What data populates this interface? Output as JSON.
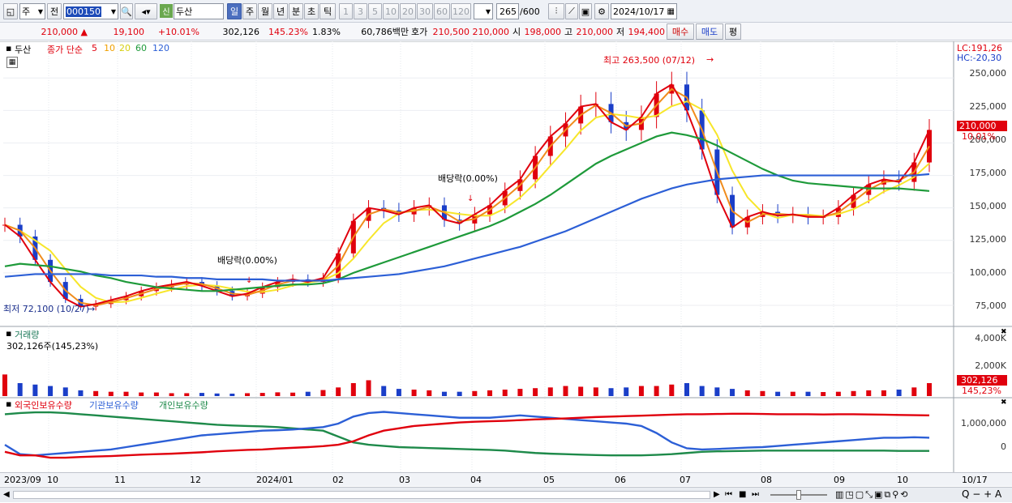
{
  "toolbar": {
    "market": "주",
    "scope": "전",
    "code": "000150",
    "name": "두산",
    "new_badge": "신",
    "period_tabs": [
      "일",
      "주",
      "월",
      "년",
      "분",
      "초",
      "틱"
    ],
    "intervals": [
      "1",
      "3",
      "5",
      "10",
      "20",
      "30",
      "60",
      "120"
    ],
    "count": "265",
    "count_total": "/600",
    "date": "2024/10/17"
  },
  "quote": {
    "price": "210,000",
    "change": "19,100",
    "change_rate": "+10.01%",
    "volume": "302,126",
    "volume_rate": "145.23%",
    "turnover_rate": "1.83%",
    "amount": "60,786백만",
    "ask_label": "호가",
    "ask": "210,500",
    "bid": "210,000",
    "open_label": "시",
    "open": "198,000",
    "high_label": "고",
    "high": "210,000",
    "low_label": "저",
    "low": "194,400",
    "buy": "매수",
    "sell": "매도",
    "flat": "평"
  },
  "price_pane": {
    "name": "두산",
    "legend_title": "종가 단순",
    "ma": [
      {
        "label": "5",
        "color": "#e0000d"
      },
      {
        "label": "10",
        "color": "#f08c1c"
      },
      {
        "label": "20",
        "color": "#e8e22b"
      },
      {
        "label": "60",
        "color": "#1e9a3a"
      },
      {
        "label": "120",
        "color": "#2c5fd6"
      }
    ],
    "high_note": "최고 263,500 (07/12)",
    "low_note": "최저 72,100 (10/27)",
    "dividend_1": "배당락(0.00%)",
    "dividend_2": "배당락(0.00%)",
    "lc": "LC:191,26",
    "hc": "HC:-20,30",
    "yticks": [
      "250,000",
      "225,000",
      "200,000",
      "175,000",
      "150,000",
      "125,000",
      "100,000",
      "75,000"
    ],
    "price_tag": "210,000",
    "price_tag_rate": "10.01%"
  },
  "volume_pane": {
    "title": "거래량",
    "info": "302,126주(145,23%)",
    "yticks": [
      "4,000K",
      "2,000K"
    ],
    "tag": "302,126",
    "tag_rate": "145,23%"
  },
  "holding_pane": {
    "series": [
      {
        "label": "외국인보유수량",
        "color": "#e0000d"
      },
      {
        "label": "기관보유수량",
        "color": "#2c5fd6"
      },
      {
        "label": "개인보유수량",
        "color": "#1e8a4a"
      }
    ],
    "yticks": [
      "1,000,000",
      "0"
    ]
  },
  "xaxis": {
    "labels": [
      "2023/09",
      "10",
      "11",
      "12",
      "2024/01",
      "02",
      "03",
      "04",
      "05",
      "06",
      "07",
      "08",
      "09",
      "10"
    ],
    "end_label": "10/17"
  },
  "chart_data": {
    "type": "line",
    "title": "두산 000150",
    "ylabel": "",
    "ylim": [
      60000,
      272000
    ],
    "series": [
      {
        "name": "종가",
        "values": [
          137000,
          128000,
          110000,
          93000,
          80000,
          74000,
          76000,
          79000,
          82000,
          86000,
          89000,
          91000,
          93000,
          90000,
          86000,
          82000,
          84000,
          89000,
          93000,
          95000,
          93000,
          96000,
          115000,
          140000,
          150000,
          148000,
          145000,
          150000,
          152000,
          141000,
          138000,
          145000,
          152000,
          163000,
          172000,
          190000,
          205000,
          215000,
          228000,
          230000,
          216000,
          210000,
          220000,
          238000,
          245000,
          225000,
          195000,
          160000,
          135000,
          143000,
          147000,
          144000,
          145000,
          143000,
          143000,
          150000,
          160000,
          168000,
          172000,
          170000,
          185000,
          210000
        ]
      },
      {
        "name": "60",
        "values": [
          105000,
          107000,
          106000,
          105000,
          103000,
          101000,
          98000,
          96000,
          93000,
          91000,
          89000,
          88000,
          87000,
          86000,
          86000,
          87000,
          88000,
          89000,
          90000,
          91000,
          91000,
          92000,
          95000,
          100000,
          104000,
          108000,
          112000,
          116000,
          120000,
          124000,
          128000,
          132000,
          136000,
          141000,
          147000,
          153000,
          160000,
          168000,
          176000,
          184000,
          190000,
          195000,
          200000,
          205000,
          208000,
          206000,
          203000,
          198000,
          192000,
          186000,
          180000,
          175000,
          171000,
          169000,
          168000,
          167000,
          166000,
          165000,
          165000,
          165000,
          164000,
          163000
        ]
      },
      {
        "name": "120",
        "values": [
          97000,
          98000,
          99000,
          99000,
          99000,
          99000,
          99000,
          98000,
          98000,
          98000,
          97000,
          97000,
          96000,
          96000,
          95000,
          95000,
          95000,
          95000,
          94000,
          94000,
          94000,
          94000,
          95000,
          96000,
          97000,
          98000,
          99000,
          101000,
          103000,
          105000,
          108000,
          111000,
          114000,
          117000,
          120000,
          124000,
          128000,
          132000,
          137000,
          142000,
          147000,
          152000,
          157000,
          161000,
          165000,
          168000,
          170000,
          172000,
          173000,
          174000,
          175000,
          175000,
          175000,
          175000,
          175000,
          175000,
          175000,
          175000,
          175000,
          175000,
          175000,
          176000
        ]
      }
    ],
    "volume_bars_k": [
      1500,
      900,
      800,
      700,
      600,
      400,
      350,
      300,
      300,
      250,
      250,
      200,
      200,
      220,
      180,
      170,
      200,
      220,
      260,
      240,
      300,
      420,
      600,
      900,
      1100,
      700,
      500,
      450,
      400,
      300,
      300,
      350,
      400,
      450,
      500,
      550,
      600,
      700,
      650,
      600,
      550,
      600,
      700,
      700,
      800,
      900,
      700,
      600,
      500,
      400,
      350,
      300,
      300,
      300,
      280,
      300,
      350,
      400,
      400,
      450,
      600,
      900
    ],
    "holdings": {
      "foreign": [
        -200000,
        -350000,
        -350000,
        -450000,
        -450000,
        -420000,
        -400000,
        -380000,
        -350000,
        -320000,
        -300000,
        -280000,
        -250000,
        -220000,
        -180000,
        -150000,
        -120000,
        -100000,
        -60000,
        -30000,
        0,
        40000,
        100000,
        250000,
        500000,
        700000,
        800000,
        900000,
        950000,
        1000000,
        1050000,
        1080000,
        1100000,
        1120000,
        1150000,
        1180000,
        1200000,
        1220000,
        1250000,
        1280000,
        1300000,
        1320000,
        1340000,
        1360000,
        1380000,
        1400000,
        1400000,
        1410000,
        1420000,
        1420000,
        1410000,
        1400000,
        1400000,
        1400000,
        1390000,
        1400000,
        1400000,
        1390000,
        1380000,
        1370000,
        1360000,
        1350000
      ],
      "institution": [
        100000,
        -300000,
        -350000,
        -300000,
        -250000,
        -200000,
        -150000,
        -100000,
        0,
        100000,
        200000,
        300000,
        400000,
        500000,
        550000,
        600000,
        650000,
        700000,
        720000,
        750000,
        800000,
        850000,
        1000000,
        1300000,
        1450000,
        1500000,
        1450000,
        1400000,
        1350000,
        1300000,
        1250000,
        1250000,
        1250000,
        1300000,
        1350000,
        1300000,
        1250000,
        1200000,
        1150000,
        1100000,
        1050000,
        1000000,
        900000,
        600000,
        200000,
        -50000,
        -100000,
        -80000,
        -50000,
        -20000,
        0,
        50000,
        100000,
        150000,
        200000,
        250000,
        300000,
        350000,
        400000,
        400000,
        420000,
        400000
      ],
      "individual": [
        1400000,
        1450000,
        1480000,
        1480000,
        1450000,
        1400000,
        1350000,
        1300000,
        1250000,
        1200000,
        1150000,
        1100000,
        1050000,
        1000000,
        950000,
        920000,
        900000,
        880000,
        850000,
        800000,
        750000,
        700000,
        450000,
        200000,
        100000,
        50000,
        0,
        -20000,
        -40000,
        -60000,
        -80000,
        -100000,
        -120000,
        -150000,
        -200000,
        -250000,
        -280000,
        -300000,
        -320000,
        -340000,
        -350000,
        -350000,
        -350000,
        -330000,
        -300000,
        -250000,
        -200000,
        -180000,
        -170000,
        -160000,
        -150000,
        -150000,
        -150000,
        -150000,
        -150000,
        -150000,
        -150000,
        -150000,
        -150000,
        -160000,
        -160000,
        -160000
      ]
    }
  }
}
